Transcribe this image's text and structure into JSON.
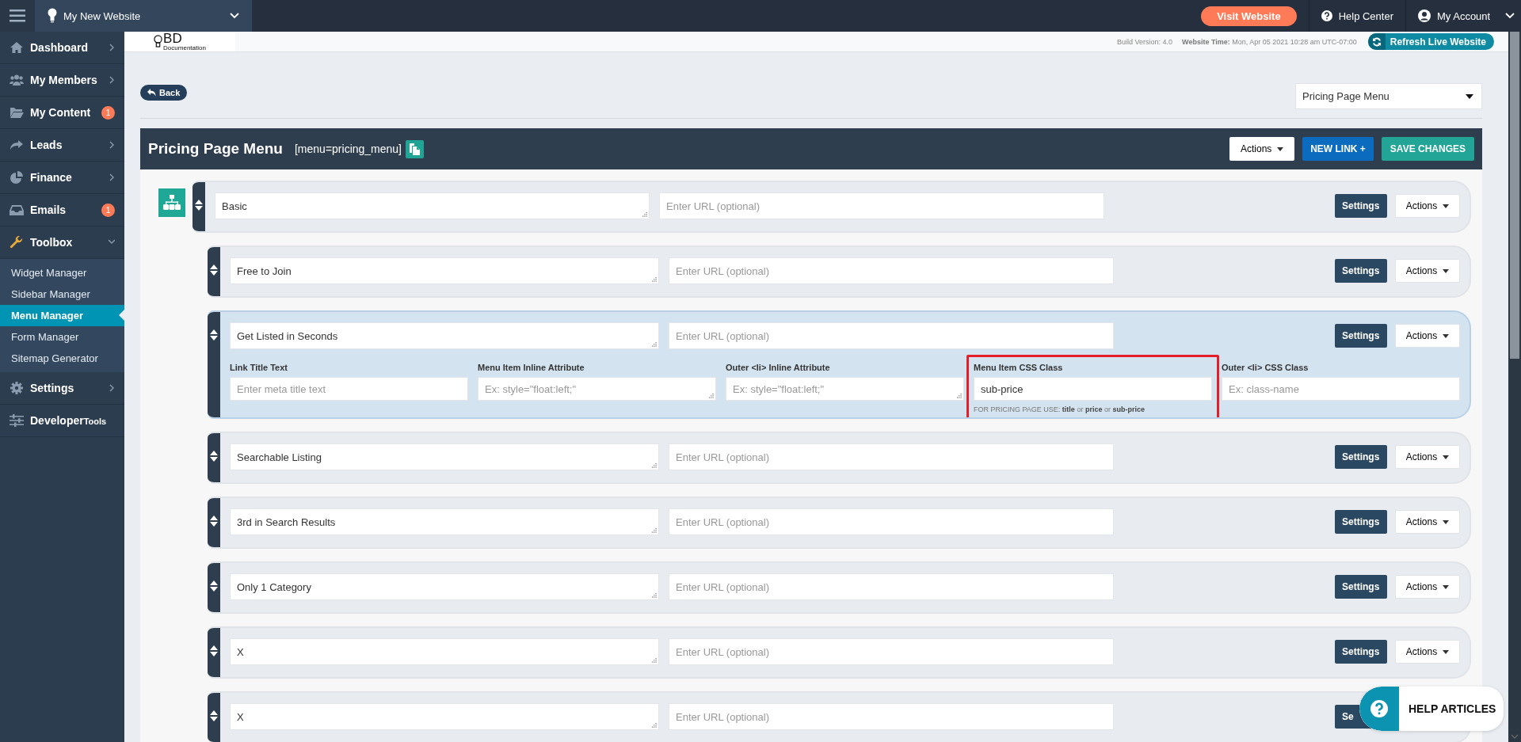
{
  "topbar": {
    "site_name": "My New Website",
    "visit_button": "Visit Website",
    "help_center": "Help Center",
    "account": "My Account"
  },
  "sidebar": {
    "items": [
      {
        "label": "Dashboard",
        "expanded": false
      },
      {
        "label": "My Members",
        "expanded": false
      },
      {
        "label": "My Content",
        "badge": "1"
      },
      {
        "label": "Leads",
        "expanded": false
      },
      {
        "label": "Finance",
        "expanded": false
      },
      {
        "label": "Emails",
        "badge": "1"
      },
      {
        "label": "Toolbox",
        "expanded": true,
        "children": [
          {
            "label": "Widget Manager",
            "selected": false
          },
          {
            "label": "Sidebar Manager",
            "selected": false
          },
          {
            "label": "Menu Manager",
            "selected": true
          },
          {
            "label": "Form Manager",
            "selected": false
          },
          {
            "label": "Sitemap Generator",
            "selected": false
          }
        ]
      },
      {
        "label": "Settings",
        "expanded": false
      },
      {
        "label": "Developer",
        "suffix": "Tools"
      }
    ]
  },
  "header": {
    "logo": "BD",
    "logo_subtitle": "Documentation",
    "build_version": "Build Version: 4.0",
    "time_label": "Website Time:",
    "time_value": "Mon, Apr 05 2021 10:28 am UTC-07:00",
    "refresh_button": "Refresh Live Website"
  },
  "back_button": "Back",
  "menu_select": {
    "value": "Pricing Page Menu"
  },
  "panel": {
    "title": "Pricing Page Menu",
    "shortcode": "[menu=pricing_menu]",
    "actions_button": "Actions",
    "new_link_button": "NEW LINK +",
    "save_button": "SAVE CHANGES"
  },
  "menu_items": [
    {
      "title": "Basic",
      "url_placeholder": "Enter URL (optional)",
      "settings_button": "Settings",
      "actions_button": "Actions",
      "expanded": false,
      "children": [
        {
          "title": "Free to Join",
          "url_placeholder": "Enter URL (optional)",
          "settings_button": "Settings",
          "actions_button": "Actions",
          "expanded": false
        },
        {
          "title": "Get Listed in Seconds",
          "url_placeholder": "Enter URL (optional)",
          "settings_button": "Settings",
          "actions_button": "Actions",
          "expanded": true,
          "fields": [
            {
              "label": "Link Title Text",
              "kind": "input",
              "placeholder": "Enter meta title text"
            },
            {
              "label": "Menu Item Inline Attribute",
              "kind": "textarea",
              "placeholder": "Ex: style=\"float:left;\""
            },
            {
              "label": "Outer <li> Inline Attribute",
              "kind": "textarea",
              "placeholder": "Ex: style=\"float:left;\""
            },
            {
              "label": "Menu Item CSS Class",
              "kind": "input",
              "value": "sub-price",
              "help": "FOR PRICING PAGE USE: **title** or **price** or **sub-price**",
              "highlighted": true
            },
            {
              "label": "Outer <li> CSS Class",
              "kind": "input",
              "placeholder": "Ex: class-name"
            }
          ]
        },
        {
          "title": "Searchable Listing",
          "url_placeholder": "Enter URL (optional)",
          "settings_button": "Settings",
          "actions_button": "Actions",
          "expanded": false
        },
        {
          "title": "3rd in Search Results",
          "url_placeholder": "Enter URL (optional)",
          "settings_button": "Settings",
          "actions_button": "Actions",
          "expanded": false
        },
        {
          "title": "Only 1 Category",
          "url_placeholder": "Enter URL (optional)",
          "settings_button": "Settings",
          "actions_button": "Actions",
          "expanded": false
        },
        {
          "title": "X",
          "url_placeholder": "Enter URL (optional)",
          "settings_button": "Settings",
          "actions_button": "Actions",
          "expanded": false
        },
        {
          "title": "X",
          "url_placeholder": "Enter URL (optional)",
          "settings_button": "Se",
          "expanded": false
        }
      ]
    }
  ],
  "help_widget": {
    "label": "HELP ARTICLES"
  }
}
